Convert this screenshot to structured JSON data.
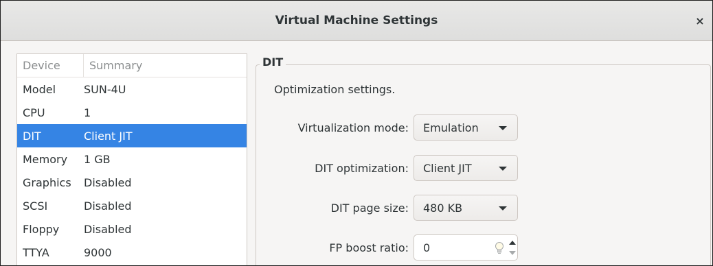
{
  "window": {
    "title": "Virtual Machine Settings",
    "close_glyph": "×"
  },
  "device_list": {
    "columns": [
      "Device",
      "Summary"
    ],
    "rows": [
      {
        "device": "Model",
        "summary": "SUN-4U"
      },
      {
        "device": "CPU",
        "summary": "1"
      },
      {
        "device": "DIT",
        "summary": "Client JIT",
        "selected": true
      },
      {
        "device": "Memory",
        "summary": "1 GB"
      },
      {
        "device": "Graphics",
        "summary": "Disabled"
      },
      {
        "device": "SCSI",
        "summary": "Disabled"
      },
      {
        "device": "Floppy",
        "summary": "Disabled"
      },
      {
        "device": "TTYA",
        "summary": "9000"
      }
    ]
  },
  "panel": {
    "frame_title": "DIT",
    "description": "Optimization settings.",
    "fields": {
      "virtualization_mode": {
        "label": "Virtualization mode:",
        "value": "Emulation"
      },
      "dit_optimization": {
        "label": "DIT optimization:",
        "value": "Client JIT"
      },
      "dit_page_size": {
        "label": "DIT page size:",
        "value": "480 KB"
      },
      "fp_boost_ratio": {
        "label": "FP boost ratio:",
        "value": "0"
      }
    }
  },
  "colors": {
    "selection": "#3584e4",
    "window_bg": "#f6f5f4",
    "text": "#2e3436"
  },
  "icons": {
    "close": "close-icon",
    "dropdown": "chevron-down-icon",
    "hint": "lightbulb-icon",
    "spin_up": "spin-up-icon",
    "spin_down": "spin-down-icon"
  }
}
